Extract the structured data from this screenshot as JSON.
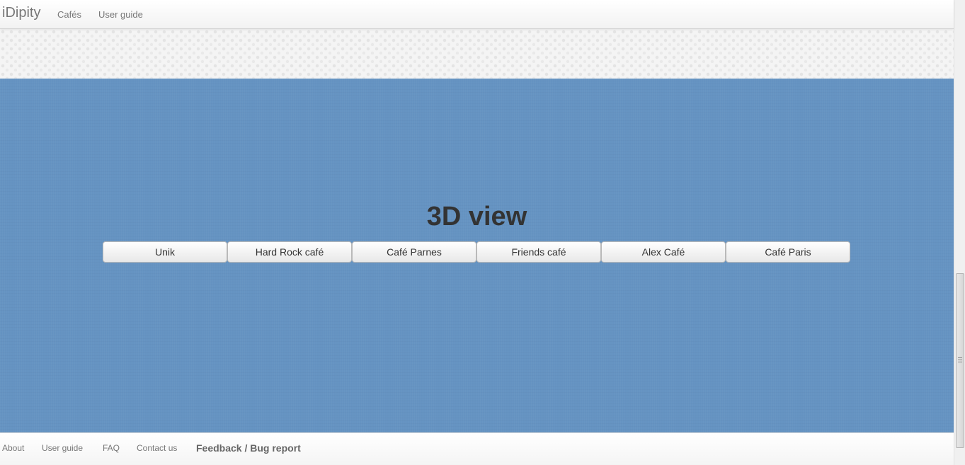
{
  "navbar": {
    "brand": "iDipity",
    "links": [
      "Cafés",
      "User guide"
    ]
  },
  "stage": {
    "title": "3D view",
    "cafes": [
      "Unik",
      "Hard Rock café",
      "Café Parnes",
      "Friends café",
      "Alex Café",
      "Café Paris"
    ]
  },
  "footer": {
    "about": "About",
    "user_guide": "User guide",
    "faq": "FAQ",
    "contact": "Contact us",
    "feedback": "Feedback / Bug report"
  },
  "colors": {
    "stage_blue": "#6593c2",
    "title_text": "#333333",
    "nav_text": "#777777"
  }
}
